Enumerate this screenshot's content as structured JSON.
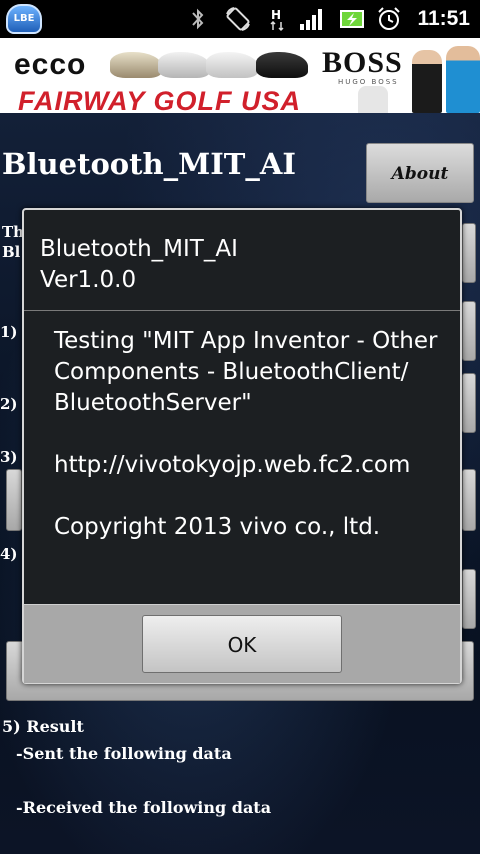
{
  "status_bar": {
    "badge": "LBE",
    "time": "11:51",
    "icons": [
      "lbe-badge",
      "bluetooth-icon",
      "screen-rotation-icon",
      "hspa-icon",
      "signal-icon",
      "battery-charging-icon",
      "alarm-clock-icon"
    ]
  },
  "ad": {
    "brand_left": "ecco",
    "brand_right": "BOSS",
    "brand_right_sub": "HUGO BOSS",
    "store": "FAIRWAY GOLF USA"
  },
  "app": {
    "title": "Bluetooth_MIT_AI",
    "about_button": "About",
    "visible_prefixes": {
      "line_a": "Th",
      "line_b": "Bl",
      "step_1": "1)",
      "step_2": "2)",
      "step_3": "3)",
      "step_4": "4)"
    },
    "result": {
      "heading": "5) Result",
      "sent": "-Sent the following data",
      "received": "-Received the following data"
    }
  },
  "dialog": {
    "title": "Bluetooth_MIT_AI\nVer1.0.0",
    "message": "Testing \"MIT App Inventor - Other Components - BluetoothClient/ BluetoothServer\"\n\nhttp://vivotokyojp.web.fc2.com\n\nCopyright 2013 vivo co., ltd.",
    "ok_button": "OK"
  },
  "colors": {
    "status_bar_bg": "#000000",
    "ad_red": "#d1202b",
    "dialog_bg": "#1c1f22",
    "dialog_footer": "#a8a8a8",
    "battery_green": "#6fd63a"
  }
}
